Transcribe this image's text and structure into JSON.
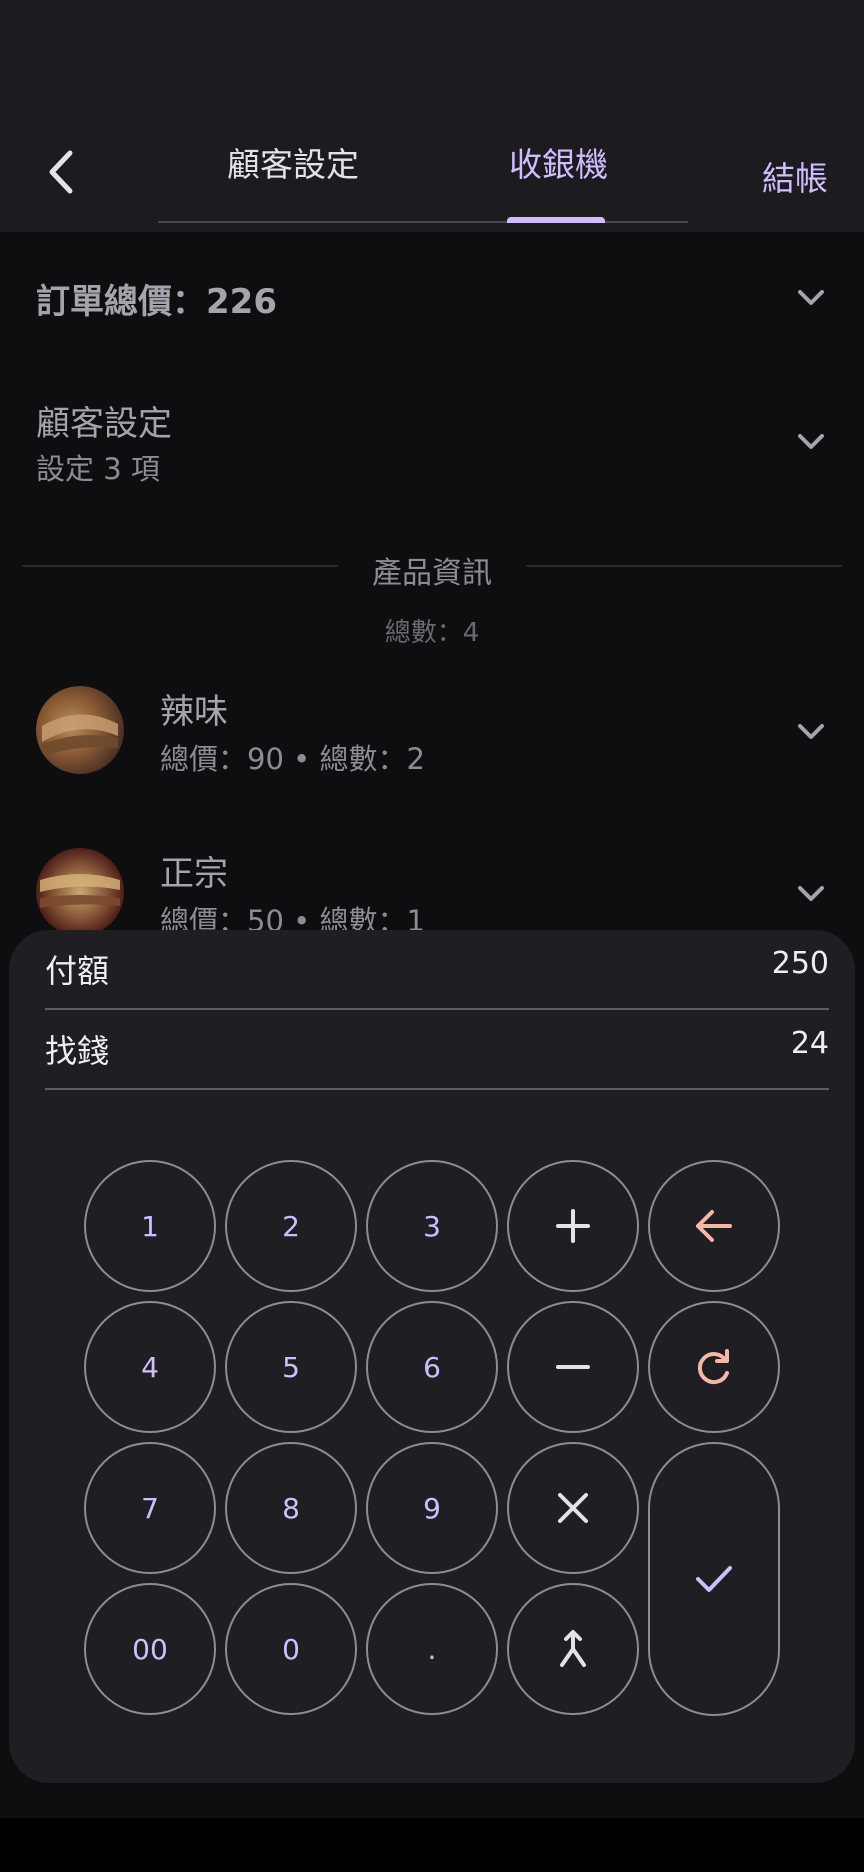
{
  "header": {
    "back_icon": "arrow-back-icon",
    "tabs": [
      {
        "label": "顧客設定",
        "active": false
      },
      {
        "label": "收銀機",
        "active": true
      }
    ],
    "checkout_label": "結帳"
  },
  "order_total": {
    "label": "訂單總價：226"
  },
  "customer_settings": {
    "title": "顧客設定",
    "subtitle": "設定 3 項"
  },
  "products": {
    "section_title": "產品資訊",
    "total_count": "總數：4",
    "items": [
      {
        "name": "辣味",
        "meta": "總價：90 • 總數：2"
      },
      {
        "name": "正宗",
        "meta": "總價：50 • 總數：1"
      }
    ]
  },
  "calculator": {
    "paid_label": "付額",
    "paid_value": "250",
    "change_label": "找錢",
    "change_value": "24",
    "keys": {
      "k1": "1",
      "k2": "2",
      "k3": "3",
      "k4": "4",
      "k5": "5",
      "k6": "6",
      "k7": "7",
      "k8": "8",
      "k9": "9",
      "k00": "00",
      "k0": "0",
      "kdot": "."
    },
    "icons": {
      "plus": "plus-icon",
      "minus": "minus-icon",
      "times": "times-icon",
      "merge": "merge-icon",
      "backspace": "backspace-icon",
      "reset": "refresh-icon",
      "confirm": "check-icon"
    }
  },
  "colors": {
    "accent": "#cfbdfe",
    "warm_accent": "#f4b8a8",
    "surface": "#1f1e23",
    "background": "#0e0e11"
  }
}
